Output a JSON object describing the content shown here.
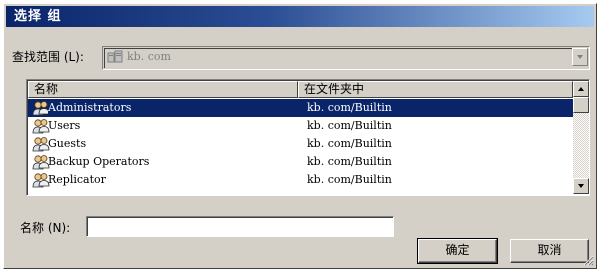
{
  "dialog": {
    "title": "选择 组"
  },
  "search_scope": {
    "label": "查找范围 (L):",
    "value": "kb. com"
  },
  "list": {
    "columns": [
      "名称",
      "在文件夹中"
    ],
    "rows": [
      {
        "name": "Administrators",
        "folder": "kb. com/Builtin",
        "selected": true
      },
      {
        "name": "Users",
        "folder": "kb. com/Builtin",
        "selected": false
      },
      {
        "name": "Guests",
        "folder": "kb. com/Builtin",
        "selected": false
      },
      {
        "name": "Backup Operators",
        "folder": "kb. com/Builtin",
        "selected": false
      },
      {
        "name": "Replicator",
        "folder": "kb. com/Builtin",
        "selected": false
      }
    ]
  },
  "name_field": {
    "label": "名称 (N):",
    "value": ""
  },
  "buttons": {
    "ok": "确定",
    "cancel": "取消"
  },
  "colors": {
    "title_start": "#0a246a",
    "title_end": "#a6caf0",
    "face": "#d4d0c8",
    "selection": "#0a246a"
  },
  "icons": {
    "scope": "domain-icon",
    "group": "group-icon"
  }
}
